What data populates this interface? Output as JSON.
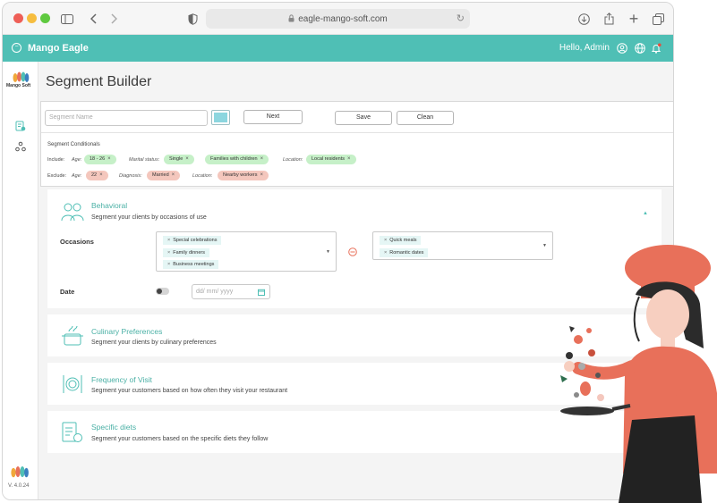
{
  "browser": {
    "url": "eagle-mango-soft.com"
  },
  "header": {
    "brand": "Mango Eagle",
    "greeting": "Hello, Admin"
  },
  "sidebar": {
    "logo_text": "Mango Soft",
    "version": "V. 4.0.24"
  },
  "page": {
    "title": "Segment Builder"
  },
  "toolbar": {
    "segment_name_placeholder": "Segment Name",
    "next_label": "Next",
    "save_label": "Save",
    "clean_label": "Clean"
  },
  "conditionals": {
    "heading": "Segment Conditionals",
    "include_label": "Include:",
    "exclude_label": "Exclude:",
    "include": {
      "age_label": "Age:",
      "age": "18 - 26",
      "marital_label": "Marital status:",
      "marital": [
        "Single",
        "Families with children"
      ],
      "location_label": "Location:",
      "location": "Local residents"
    },
    "exclude": {
      "age_label": "Age:",
      "age": "22",
      "diagnosis_label": "Diagnosis:",
      "diagnosis": "Married",
      "location_label": "Location:",
      "location": "Nearby workers"
    }
  },
  "behavioral": {
    "title": "Behavioral",
    "description": "Segment your clients by occasions of use",
    "occasions_label": "Occasions",
    "occasions_left": [
      "Special celebrations",
      "Family dinners",
      "Business meetings"
    ],
    "occasions_right": [
      "Quick meals",
      "Romantic dates"
    ],
    "date_label": "Date",
    "date_placeholder": "dd/ mm/ yyyy"
  },
  "cards": [
    {
      "title": "Culinary Preferences",
      "description": "Segment your clients by culinary preferences"
    },
    {
      "title": "Frequency of Visit",
      "description": "Segment your customers based on how often they visit your restaurant"
    },
    {
      "title": "Specific diets",
      "description": "Segment your customers based on the specific diets they follow"
    }
  ],
  "colors": {
    "accent": "#4fbfb5",
    "chip_include": "#c6f0c8",
    "chip_exclude": "#f4c7bd",
    "chef_orange": "#e8705a"
  },
  "icons": [
    "sidebar-toggle-icon",
    "back-icon",
    "forward-icon",
    "shield-icon",
    "lock-icon",
    "reload-icon",
    "download-icon",
    "share-icon",
    "new-tab-icon",
    "tabs-icon",
    "user-icon",
    "globe-icon",
    "bell-icon"
  ]
}
